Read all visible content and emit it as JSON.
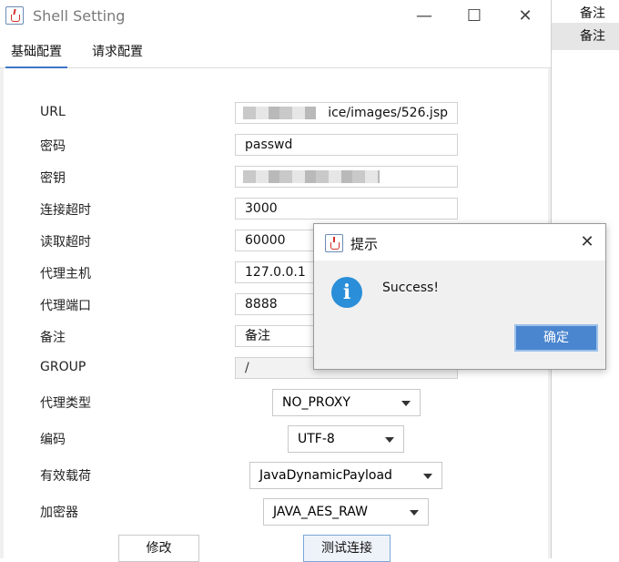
{
  "background_list": {
    "items": [
      "备注",
      "备注"
    ]
  },
  "window": {
    "title": "Shell Setting",
    "minimize": "—",
    "maximize": "☐",
    "close": "✕"
  },
  "tabs": [
    "基础配置",
    "请求配置"
  ],
  "form": {
    "url_label": "URL",
    "url_value": "ice/images/526.jsp",
    "password_label": "密码",
    "password_value": "passwd",
    "key_label": "密钥",
    "connect_timeout_label": "连接超时",
    "connect_timeout_value": "3000",
    "read_timeout_label": "读取超时",
    "read_timeout_value": "60000",
    "proxy_host_label": "代理主机",
    "proxy_host_value": "127.0.0.1",
    "proxy_port_label": "代理端口",
    "proxy_port_value": "8888",
    "remark_label": "备注",
    "remark_value": "备注",
    "group_label": "GROUP",
    "group_value": "/",
    "proxy_type_label": "代理类型",
    "proxy_type_value": "NO_PROXY",
    "encoding_label": "编码",
    "encoding_value": "UTF-8",
    "payload_label": "有效载荷",
    "payload_value": "JavaDynamicPayload",
    "encryptor_label": "加密器",
    "encryptor_value": "JAVA_AES_RAW"
  },
  "buttons": {
    "modify": "修改",
    "test_connection": "测试连接"
  },
  "dialog": {
    "title": "提示",
    "close": "✕",
    "icon_glyph": "i",
    "message": "Success!",
    "ok": "确定"
  }
}
